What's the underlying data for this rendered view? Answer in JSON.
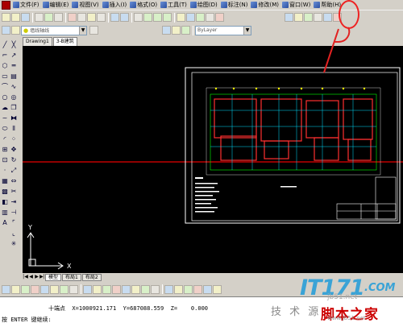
{
  "menu": {
    "items": [
      "文件",
      "编辑",
      "视图",
      "插入",
      "格式",
      "工具",
      "绘图",
      "标注",
      "修改",
      "窗口",
      "帮助"
    ],
    "hotkeys": [
      "(F)",
      "(E)",
      "(V)",
      "(I)",
      "(O)",
      "(T)",
      "(D)",
      "(N)",
      "(M)",
      "(W)",
      "(H)"
    ]
  },
  "toolbar2": {
    "layer_combo": "ByLayer",
    "linetype_combo": "墙线轴线"
  },
  "doc_tabs": [
    "Drawing1",
    "3-B建筑"
  ],
  "layout_tabs": [
    "模型",
    "布局1",
    "布局2"
  ],
  "status": {
    "coords": "十端点  X=1000921.171  Y=687088.559  Z=    0.000"
  },
  "command": {
    "prompt": "按 ENTER 键继续:"
  },
  "watermark": {
    "logo": "IT171",
    "logo_suffix": ".COM",
    "sub": "技 术 源",
    "jb": "jb51.net",
    "cn": "脚本之家",
    "url": "www.jb51.net"
  },
  "ucs": {
    "x_label": "X",
    "y_label": "Y"
  },
  "colors": {
    "canvas": "#000000",
    "annotation": "#e22222",
    "crosshair": "#c00000"
  }
}
